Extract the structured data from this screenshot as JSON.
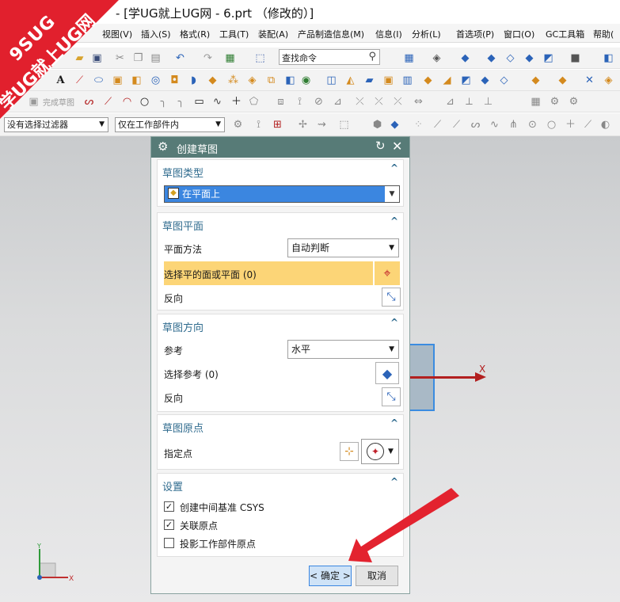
{
  "window": {
    "title": "- [学UG就上UG网 - 6.prt （修改的）]",
    "logo_text_1": "9SUG",
    "logo_text_2": "学UG就上UG网"
  },
  "menu": {
    "items": [
      "视图(V)",
      "插入(S)",
      "格式(R)",
      "工具(T)",
      "装配(A)",
      "产品制造信息(M)",
      "信息(I)",
      "分析(L)",
      "首选项(P)",
      "窗口(O)",
      "GC工具箱",
      "帮助("
    ]
  },
  "toolbar": {
    "command_search_placeholder": "查找命令",
    "finish_sketch_label": "完成草图",
    "text_tool_label": "A"
  },
  "filters": {
    "selection_filter": "没有选择过滤器",
    "scope": "仅在工作部件内"
  },
  "dialog": {
    "title": "创建草图",
    "sketch_type": {
      "section_title": "草图类型",
      "selected": "在平面上"
    },
    "sketch_plane": {
      "section_title": "草图平面",
      "method_label": "平面方法",
      "method_value": "自动判断",
      "select_label": "选择平的面或平面 (0)",
      "reverse_label": "反向"
    },
    "sketch_orientation": {
      "section_title": "草图方向",
      "reference_label": "参考",
      "reference_value": "水平",
      "select_ref_label": "选择参考 (0)",
      "reverse_label": "反向"
    },
    "sketch_origin": {
      "section_title": "草图原点",
      "point_label": "指定点"
    },
    "settings": {
      "section_title": "设置",
      "options": [
        {
          "label": "创建中间基准 CSYS",
          "checked": true
        },
        {
          "label": "关联原点",
          "checked": true
        },
        {
          "label": "投影工作部件原点",
          "checked": false
        }
      ]
    },
    "ok_label": "< 确定 >",
    "cancel_label": "取消"
  },
  "viewport": {
    "x_axis_label": "X",
    "triad_x": "X",
    "triad_y": "Y"
  },
  "colors": {
    "dialog_header": "#577b77",
    "section_title": "#2f6b8e",
    "highlight_row": "#fcd577",
    "selected_dropdown": "#3b86e0",
    "ok_button": "#cfe3f7",
    "logo": "#e1202d",
    "axis_red": "#b21f1f"
  }
}
